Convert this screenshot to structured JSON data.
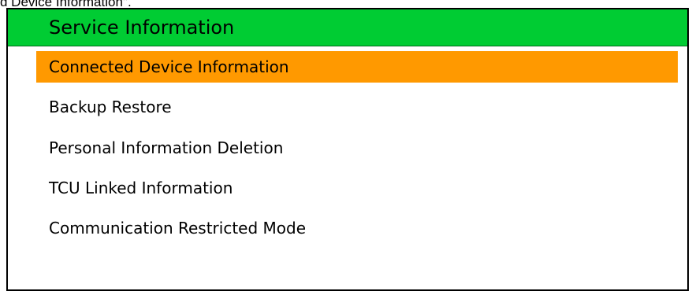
{
  "caption": "d Device Information\".",
  "panel": {
    "title": "Service Information",
    "header_color": "#00cc33",
    "selected_color": "#ff9900",
    "items": [
      {
        "label": "Connected Device Information",
        "selected": true
      },
      {
        "label": "Backup Restore",
        "selected": false
      },
      {
        "label": "Personal Information Deletion",
        "selected": false
      },
      {
        "label": "TCU Linked Information",
        "selected": false
      },
      {
        "label": "Communication Restricted Mode",
        "selected": false
      }
    ]
  }
}
